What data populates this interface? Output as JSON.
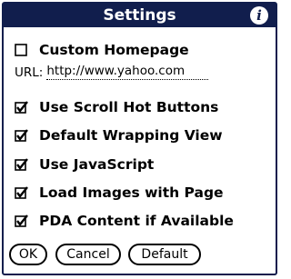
{
  "dialog": {
    "title": "Settings",
    "info_icon_glyph": "i"
  },
  "custom_homepage": {
    "label": "Custom Homepage",
    "checked": false
  },
  "url": {
    "label": "URL:",
    "value": "http://www.yahoo.com"
  },
  "options": [
    {
      "label": "Use Scroll Hot Buttons",
      "checked": true
    },
    {
      "label": "Default Wrapping View",
      "checked": true
    },
    {
      "label": "Use JavaScript",
      "checked": true
    },
    {
      "label": "Load Images with Page",
      "checked": true
    },
    {
      "label": "PDA Content if Available",
      "checked": true
    }
  ],
  "buttons": {
    "ok": "OK",
    "cancel": "Cancel",
    "default": "Default"
  },
  "colors": {
    "titlebar": "#111e4d",
    "background": "#ffffff"
  },
  "icons": {
    "info": "info-icon",
    "checked": "checkbox-checked-icon",
    "unchecked": "checkbox-unchecked-icon"
  }
}
